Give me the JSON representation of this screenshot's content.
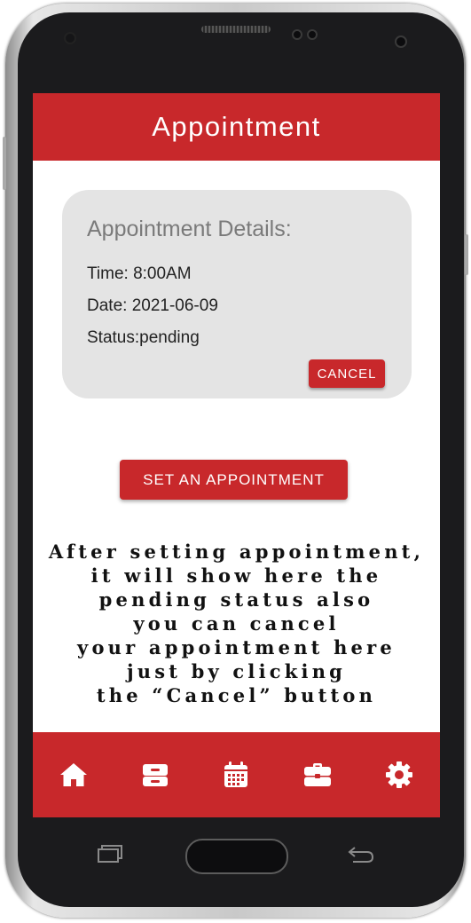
{
  "header": {
    "title": "Appointment"
  },
  "card": {
    "title": "Appointment Details:",
    "time": "Time: 8:00AM",
    "date": "Date: 2021-06-09",
    "status": "Status:pending",
    "cancel_label": "CANCEL"
  },
  "set_button_label": "SET AN APPOINTMENT",
  "note_lines": [
    "After setting appointment,",
    "it will show here the",
    "pending status also",
    "you can cancel",
    "your appointment here",
    "just by clicking",
    "the “Cancel” button"
  ],
  "bottom_nav": [
    {
      "icon": "home-icon"
    },
    {
      "icon": "inbox-tray-icon"
    },
    {
      "icon": "calendar-icon"
    },
    {
      "icon": "briefcase-icon"
    },
    {
      "icon": "gear-icon"
    }
  ],
  "colors": {
    "accent": "#c8282b",
    "card_bg": "#e4e4e4"
  }
}
